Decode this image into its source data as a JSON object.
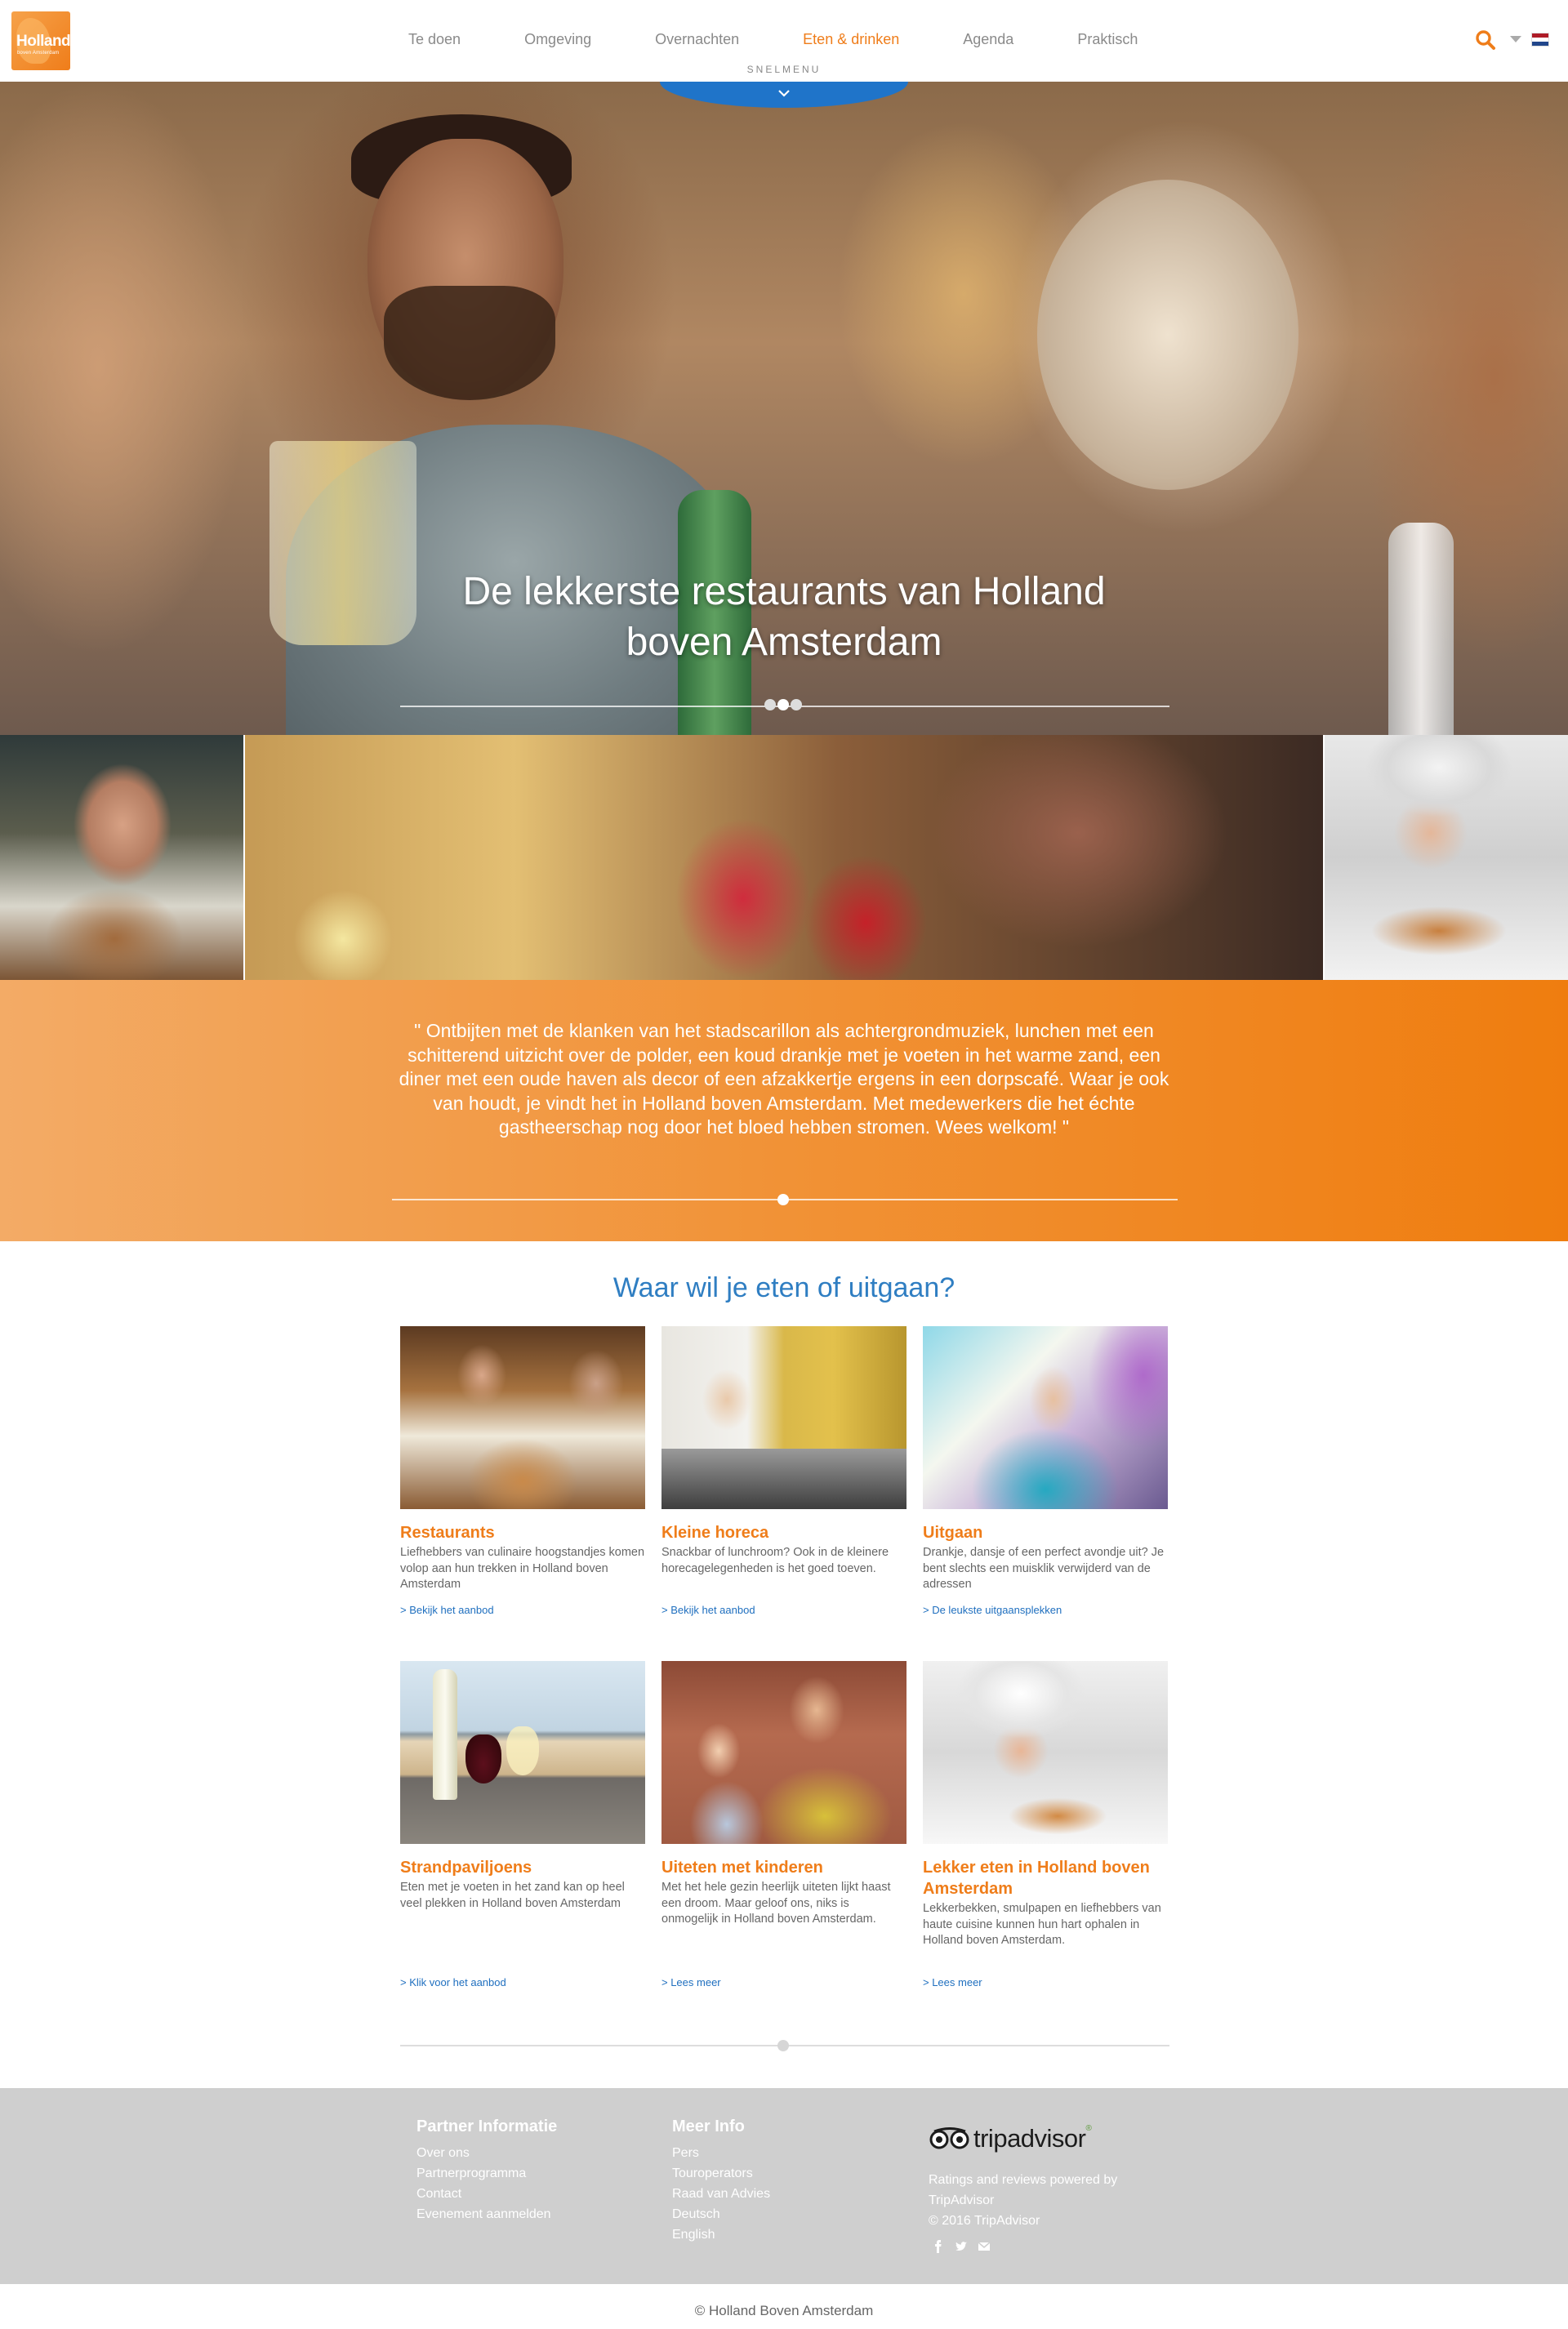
{
  "logo": {
    "text": "Holland",
    "subtext": "boven Amsterdam"
  },
  "nav": {
    "items": [
      {
        "label": "Te doen",
        "active": false
      },
      {
        "label": "Omgeving",
        "active": false
      },
      {
        "label": "Overnachten",
        "active": false
      },
      {
        "label": "Eten & drinken",
        "active": true
      },
      {
        "label": "Agenda",
        "active": false
      },
      {
        "label": "Praktisch",
        "active": false
      }
    ],
    "search_icon": "search-icon",
    "language_flag": "nl-flag-icon"
  },
  "snelmenu": {
    "label": "SNELMENU"
  },
  "hero": {
    "title_line1": "De lekkerste restaurants van Holland",
    "title_line2": "boven Amsterdam",
    "slides_total": 3,
    "active_slide": 2
  },
  "quote": {
    "text": "\" Ontbijten met de klanken van het stadscarillon als achtergrondmuziek, lunchen met een schitterend uitzicht over de polder, een koud drankje met je voeten in het warme zand, een diner met een oude haven als decor of een afzakkertje ergens in een dorpscafé. Waar je ook van houdt, je vindt het in Holland boven Amsterdam. Met medewerkers die het échte gastheerschap nog door het bloed hebben stromen. Wees welkom! \""
  },
  "section": {
    "title": "Waar wil je eten of uitgaan?",
    "cards": [
      {
        "title": "Restaurants",
        "text": "Liefhebbers van culinaire hoogstandjes komen volop aan hun trekken in Holland boven Amsterdam",
        "link": "> Bekijk het aanbod"
      },
      {
        "title": "Kleine horeca",
        "text": "Snackbar of lunchroom? Ook in de kleinere horecagelegenheden is het goed toeven.",
        "link": "> Bekijk het aanbod"
      },
      {
        "title": "Uitgaan",
        "text": "Drankje, dansje of een perfect avondje uit? Je bent slechts een muisklik verwijderd van de adressen",
        "link": "> De leukste uitgaansplekken"
      },
      {
        "title": "Strandpaviljoens",
        "text": "Eten met je voeten in het zand kan op heel veel plekken in Holland boven Amsterdam",
        "link": "> Klik voor het aanbod"
      },
      {
        "title": "Uiteten met kinderen",
        "text": "Met het hele gezin heerlijk uiteten lijkt haast een droom. Maar geloof ons, niks is onmogelijk in Holland boven Amsterdam.",
        "link": "> Lees meer"
      },
      {
        "title": "Lekker eten in Holland boven Amsterdam",
        "text": "Lekkerbekken, smulpapen en liefhebbers van haute cuisine kunnen hun hart ophalen in Holland boven Amsterdam.",
        "link": "> Lees meer"
      }
    ]
  },
  "footer": {
    "col1": {
      "heading": "Partner Informatie",
      "links": [
        "Over ons",
        "Partnerprogramma",
        "Contact",
        "Evenement aanmelden"
      ]
    },
    "col2": {
      "heading": "Meer Info",
      "links": [
        "Pers",
        "Touroperators",
        "Raad van Advies",
        "Deutsch",
        "English"
      ]
    },
    "tripadvisor": {
      "brand": "tripadvisor",
      "line1": "Ratings and reviews powered by",
      "line2": "TripAdvisor",
      "line3": "© 2016 TripAdvisor"
    },
    "social": [
      "facebook-icon",
      "twitter-icon",
      "mail-icon"
    ]
  },
  "copyright": "© Holland Boven Amsterdam",
  "colors": {
    "accent_orange": "#ef7d1a",
    "accent_blue": "#2f7ec2",
    "link_blue": "#1f6fbf",
    "footer_grey": "#cfcfcf"
  }
}
